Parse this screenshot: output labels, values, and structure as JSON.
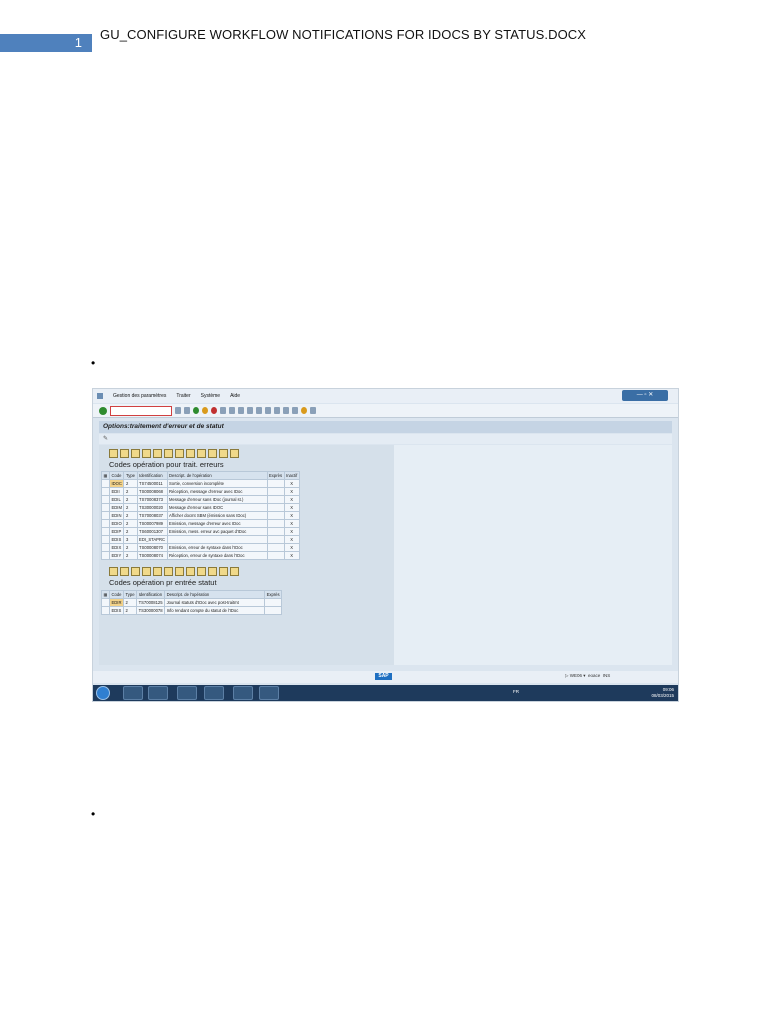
{
  "header": {
    "page_number": "1",
    "title": "GU_CONFIGURE WORKFLOW NOTIFICATIONS FOR IDOCS BY STATUS.DOCX"
  },
  "bullets": [
    "•",
    "•"
  ],
  "sap": {
    "menu": [
      "Gestion des paramètres",
      "Traiter",
      "Système",
      "Aide"
    ],
    "screen_title": "Options:traitement d'erreur et de statut",
    "section1": {
      "title": "Codes opération pour trait. erreurs",
      "headers": [
        "Code",
        "Type",
        "Identification",
        "Descript. de l'opération",
        "Exprès",
        "Inactif"
      ],
      "rows": [
        [
          "IDOC",
          "2",
          "TS74500011",
          "Sortie, conversion incomplète",
          "",
          "X"
        ],
        [
          "EDII",
          "2",
          "TS00008068",
          "Réception, message d'erreur avec IDoc",
          "",
          "X"
        ],
        [
          "EDIL",
          "2",
          "TS70008373",
          "Message d'erreur sans IDoc (journal st.)",
          "",
          "X"
        ],
        [
          "EDIM",
          "2",
          "TS30000020",
          "Message d'erreur sans IDOC",
          "",
          "X"
        ],
        [
          "EDIN",
          "2",
          "TS70008037",
          "Afficher docmt SBM (émission sans IDoc)",
          "",
          "X"
        ],
        [
          "EDIO",
          "2",
          "TS00007989",
          "Emission, message d'erreur avec IDoc",
          "",
          "X"
        ],
        [
          "EDIP",
          "2",
          "TS60001307",
          "Emission, mess. erreur avc paquet d'IDoc",
          "",
          "X"
        ],
        [
          "EDIS",
          "3",
          "EDI_STAPRC",
          "",
          "",
          "X"
        ],
        [
          "EDIX",
          "2",
          "TS00008070",
          "Emission, erreur de syntaxe dans l'IDoc",
          "",
          "X"
        ],
        [
          "EDIY",
          "2",
          "TS00008074",
          "Réception, erreur de syntaxe dans l'IDoc",
          "",
          "X"
        ]
      ]
    },
    "section2": {
      "title": "Codes opération pr entrée statut",
      "headers": [
        "Code",
        "Type",
        "Identification",
        "Descript. de l'opération",
        "Exprès"
      ],
      "rows": [
        [
          "EDIR",
          "2",
          "TS70008125",
          "Journal statuts d'IDoc avec post-traitmt",
          ""
        ],
        [
          "EDIS",
          "2",
          "TS30000078",
          "Info rendant compte du statut de l'IDoc",
          ""
        ]
      ]
    },
    "status_bar": {
      "logo": "SAP",
      "system": "WE06",
      "session": "eoace",
      "lang": "INS"
    },
    "taskbar": {
      "lang": "FR",
      "time": "09:06",
      "date": "08/03/2015"
    }
  }
}
